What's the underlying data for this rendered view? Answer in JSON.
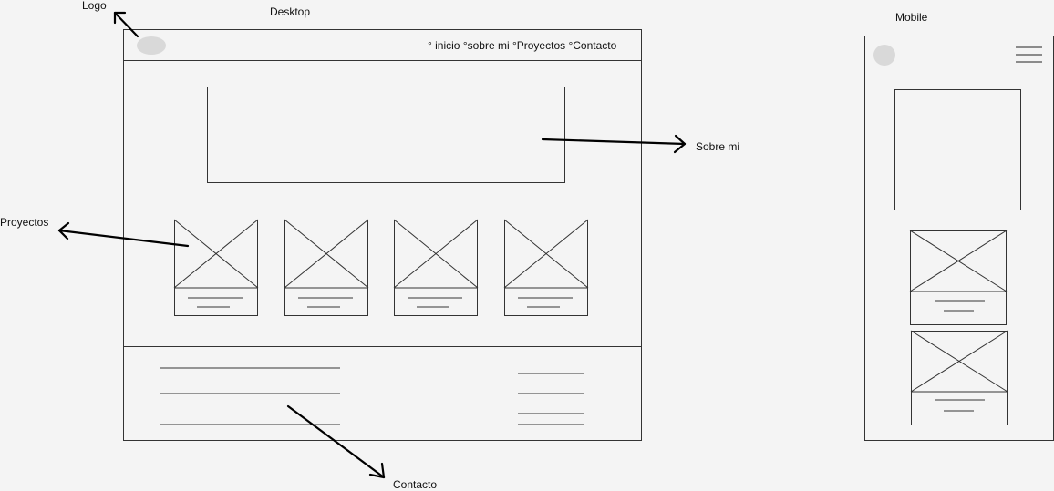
{
  "labels": {
    "desktop": "Desktop",
    "mobile": "Mobile",
    "logo": "Logo",
    "sobre_mi": "Sobre mi",
    "proyectos": "Proyectos",
    "contacto": "Contacto"
  },
  "desktop_frame": {
    "nav": "° inicio °sobre mi °Proyectos °Contacto"
  },
  "colors": {
    "background": "#f4f4f4",
    "line": "#333333",
    "logo_placeholder": "#d9d9d9",
    "arrow": "#000000"
  },
  "icons": {
    "logo": "circle-placeholder",
    "menu": "hamburger-menu-icon",
    "image": "image-placeholder-x"
  }
}
